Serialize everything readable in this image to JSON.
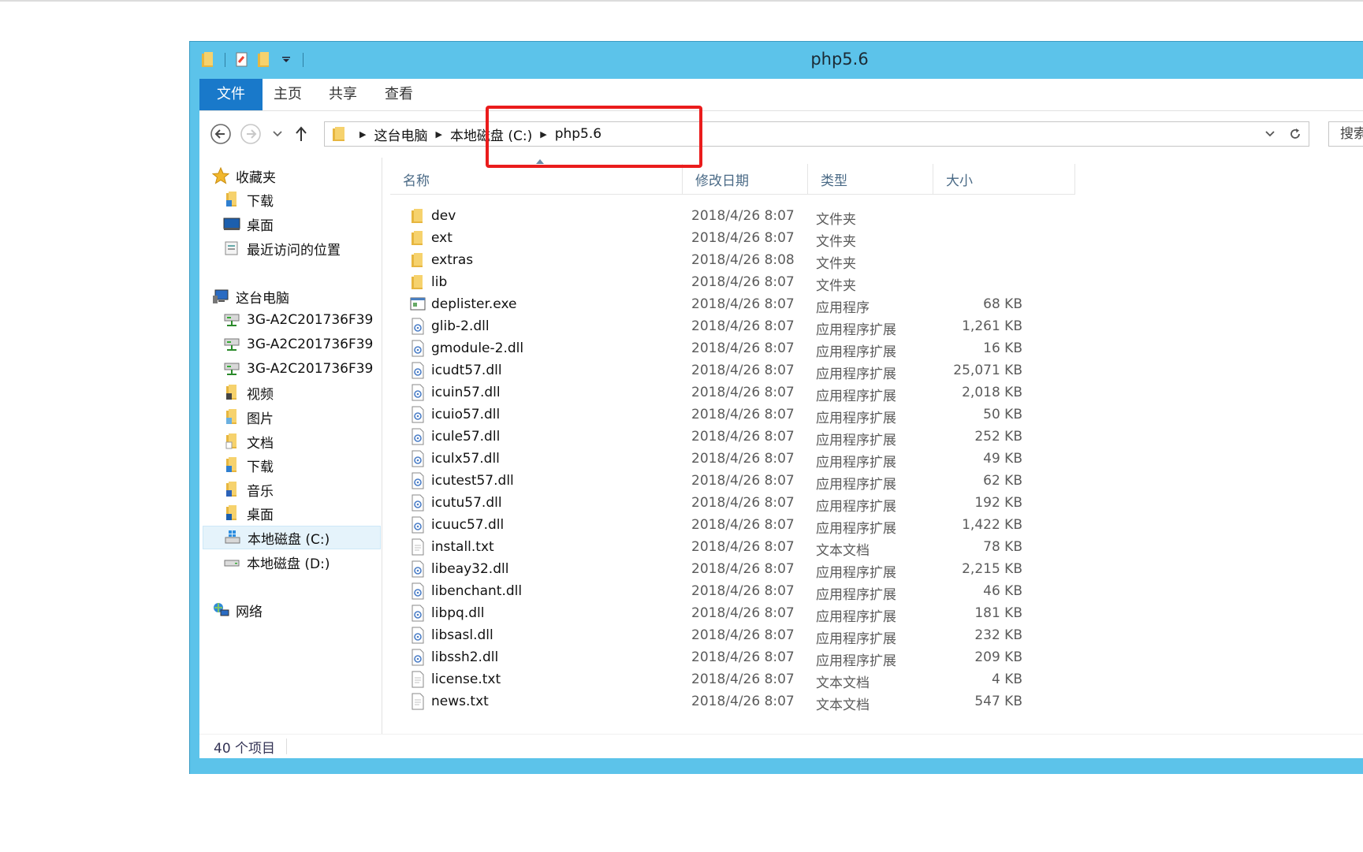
{
  "window": {
    "title": "php5.6"
  },
  "ribbon": {
    "tabs": [
      "文件",
      "主页",
      "共享",
      "查看"
    ]
  },
  "address": {
    "segments": [
      "这台电脑",
      "本地磁盘 (C:)",
      "php5.6"
    ],
    "search_label": "搜索"
  },
  "nav": {
    "favorites": {
      "label": "收藏夹",
      "items": [
        "下载",
        "桌面",
        "最近访问的位置"
      ]
    },
    "thispc": {
      "label": "这台电脑",
      "items": [
        "3G-A2C201736F39",
        "3G-A2C201736F39",
        "3G-A2C201736F39",
        "视频",
        "图片",
        "文档",
        "下载",
        "音乐",
        "桌面",
        "本地磁盘 (C:)",
        "本地磁盘 (D:)"
      ]
    },
    "network": "网络"
  },
  "columns": {
    "name": "名称",
    "date": "修改日期",
    "type": "类型",
    "size": "大小"
  },
  "files": [
    {
      "name": "dev",
      "date": "2018/4/26 8:07",
      "type": "文件夹",
      "size": "",
      "icon": "folder-icon"
    },
    {
      "name": "ext",
      "date": "2018/4/26 8:07",
      "type": "文件夹",
      "size": "",
      "icon": "folder-icon"
    },
    {
      "name": "extras",
      "date": "2018/4/26 8:08",
      "type": "文件夹",
      "size": "",
      "icon": "folder-icon"
    },
    {
      "name": "lib",
      "date": "2018/4/26 8:07",
      "type": "文件夹",
      "size": "",
      "icon": "folder-icon"
    },
    {
      "name": "deplister.exe",
      "date": "2018/4/26 8:07",
      "type": "应用程序",
      "size": "68 KB",
      "icon": "exe-icon"
    },
    {
      "name": "glib-2.dll",
      "date": "2018/4/26 8:07",
      "type": "应用程序扩展",
      "size": "1,261 KB",
      "icon": "dll-icon"
    },
    {
      "name": "gmodule-2.dll",
      "date": "2018/4/26 8:07",
      "type": "应用程序扩展",
      "size": "16 KB",
      "icon": "dll-icon"
    },
    {
      "name": "icudt57.dll",
      "date": "2018/4/26 8:07",
      "type": "应用程序扩展",
      "size": "25,071 KB",
      "icon": "dll-icon"
    },
    {
      "name": "icuin57.dll",
      "date": "2018/4/26 8:07",
      "type": "应用程序扩展",
      "size": "2,018 KB",
      "icon": "dll-icon"
    },
    {
      "name": "icuio57.dll",
      "date": "2018/4/26 8:07",
      "type": "应用程序扩展",
      "size": "50 KB",
      "icon": "dll-icon"
    },
    {
      "name": "icule57.dll",
      "date": "2018/4/26 8:07",
      "type": "应用程序扩展",
      "size": "252 KB",
      "icon": "dll-icon"
    },
    {
      "name": "iculx57.dll",
      "date": "2018/4/26 8:07",
      "type": "应用程序扩展",
      "size": "49 KB",
      "icon": "dll-icon"
    },
    {
      "name": "icutest57.dll",
      "date": "2018/4/26 8:07",
      "type": "应用程序扩展",
      "size": "62 KB",
      "icon": "dll-icon"
    },
    {
      "name": "icutu57.dll",
      "date": "2018/4/26 8:07",
      "type": "应用程序扩展",
      "size": "192 KB",
      "icon": "dll-icon"
    },
    {
      "name": "icuuc57.dll",
      "date": "2018/4/26 8:07",
      "type": "应用程序扩展",
      "size": "1,422 KB",
      "icon": "dll-icon"
    },
    {
      "name": "install.txt",
      "date": "2018/4/26 8:07",
      "type": "文本文档",
      "size": "78 KB",
      "icon": "txt-icon"
    },
    {
      "name": "libeay32.dll",
      "date": "2018/4/26 8:07",
      "type": "应用程序扩展",
      "size": "2,215 KB",
      "icon": "dll-icon"
    },
    {
      "name": "libenchant.dll",
      "date": "2018/4/26 8:07",
      "type": "应用程序扩展",
      "size": "46 KB",
      "icon": "dll-icon"
    },
    {
      "name": "libpq.dll",
      "date": "2018/4/26 8:07",
      "type": "应用程序扩展",
      "size": "181 KB",
      "icon": "dll-icon"
    },
    {
      "name": "libsasl.dll",
      "date": "2018/4/26 8:07",
      "type": "应用程序扩展",
      "size": "232 KB",
      "icon": "dll-icon"
    },
    {
      "name": "libssh2.dll",
      "date": "2018/4/26 8:07",
      "type": "应用程序扩展",
      "size": "209 KB",
      "icon": "dll-icon"
    },
    {
      "name": "license.txt",
      "date": "2018/4/26 8:07",
      "type": "文本文档",
      "size": "4 KB",
      "icon": "txt-icon"
    },
    {
      "name": "news.txt",
      "date": "2018/4/26 8:07",
      "type": "文本文档",
      "size": "547 KB",
      "icon": "txt-icon"
    }
  ],
  "status": {
    "count": "40 个项目"
  },
  "colors": {
    "titlebar": "#5cc3ea",
    "file_tab": "#1979ca",
    "highlight": "#ea1c1c"
  }
}
